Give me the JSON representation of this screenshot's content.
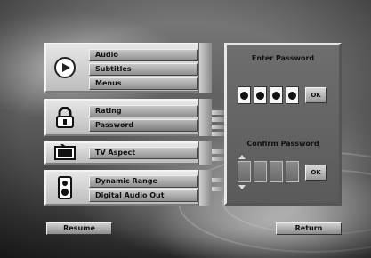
{
  "menu": {
    "groups": [
      {
        "id": "language",
        "icon": "disc-play-icon",
        "items": [
          "Audio",
          "Subtitles",
          "Menus"
        ]
      },
      {
        "id": "lock",
        "icon": "padlock-icon",
        "items": [
          "Rating",
          "Password"
        ]
      },
      {
        "id": "display",
        "icon": "tv-icon",
        "items": [
          "TV Aspect"
        ]
      },
      {
        "id": "sound",
        "icon": "speaker-icon",
        "items": [
          "Dynamic Range",
          "Digital Audio Out"
        ]
      }
    ],
    "selected": "Password"
  },
  "password_panel": {
    "enter_title": "Enter Password",
    "confirm_title": "Confirm Password",
    "entered_digits": 4,
    "ok_label": "OK",
    "confirm_ok_label": "OK"
  },
  "buttons": {
    "resume": "Resume",
    "return": "Return"
  },
  "colors": {
    "panel": "#6a6a6a",
    "button": "#c4c4c4",
    "text": "#111111"
  }
}
